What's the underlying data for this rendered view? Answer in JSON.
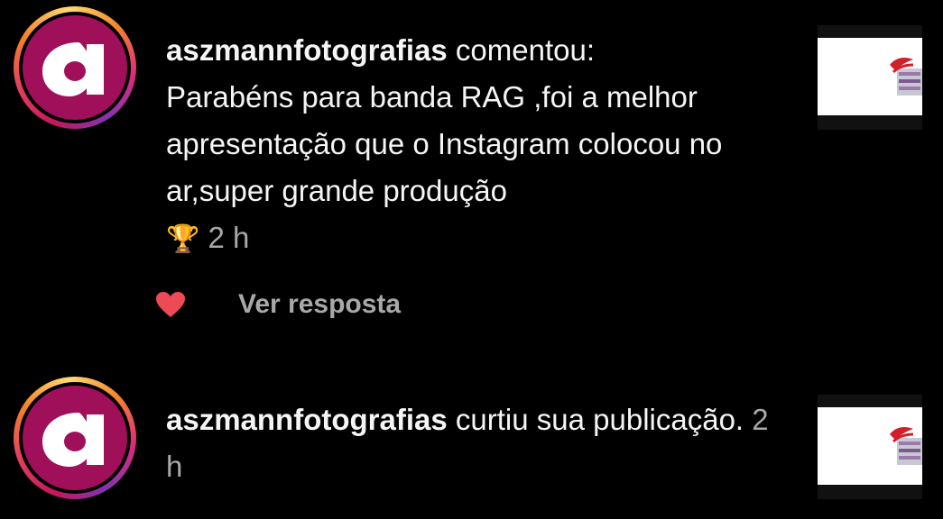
{
  "colors": {
    "background": "#000000",
    "text": "#f5f5f5",
    "muted": "#a8a8a8",
    "heart": "#ed4956",
    "avatar_bg": "#a0105a"
  },
  "notifications": [
    {
      "username": "aszmannfotografias",
      "action": " comentou:",
      "comment": "Parabéns para banda RAG ,foi a melhor apresentação que o Instagram colocou no ar,super grande produção",
      "emoji": "🏆",
      "time": "2 h",
      "liked": true,
      "reply_label": "Ver resposta",
      "icon": "heart-icon"
    },
    {
      "username": "aszmannfotografias",
      "action": " curtiu sua publicação.",
      "time": "2 h"
    }
  ]
}
